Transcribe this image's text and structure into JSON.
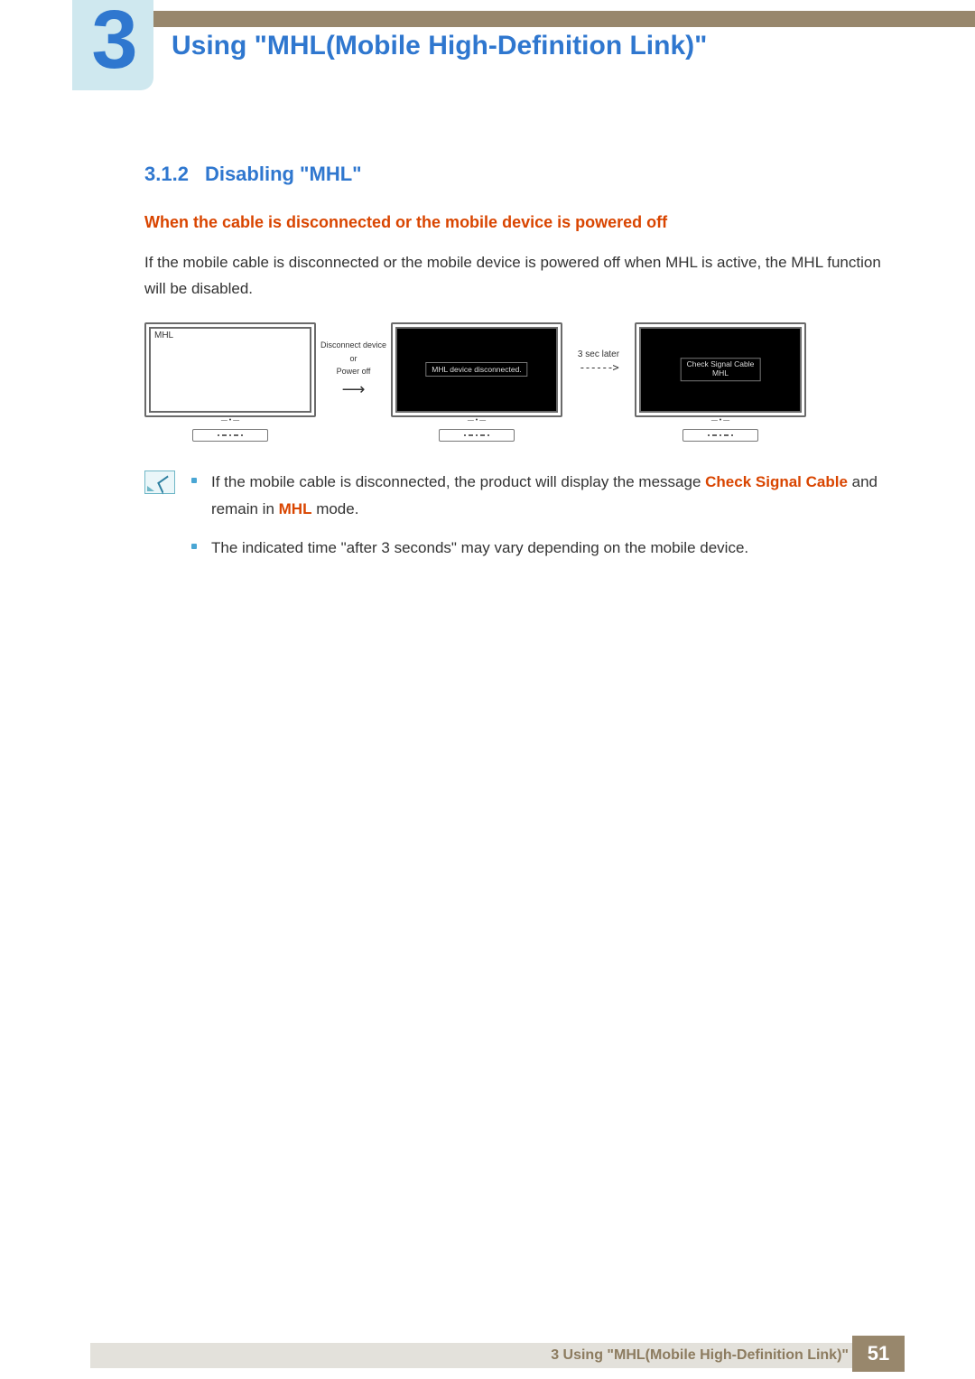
{
  "chapter": {
    "number": "3",
    "title": "Using \"MHL(Mobile High-Definition Link)\""
  },
  "section": {
    "number": "3.1.2",
    "title": "Disabling \"MHL\""
  },
  "subheading": "When the cable is disconnected or the mobile device is powered off",
  "body": "If the mobile cable is disconnected or the mobile device is powered off when MHL is active, the MHL function will be disabled.",
  "diagram": {
    "monitor1_tag": "MHL",
    "arrow1_line1": "Disconnect device",
    "arrow1_line2": "or",
    "arrow1_line3": "Power off",
    "monitor2_msg": "MHL device disconnected.",
    "arrow2_label": "3 sec later",
    "monitor3_msg_line1": "Check Signal Cable",
    "monitor3_msg_line2": "MHL"
  },
  "notes": {
    "item1_prefix": "If the mobile cable is disconnected, the product will display the message ",
    "item1_hl1": "Check Signal Cable",
    "item1_mid": " and remain in ",
    "item1_hl2": "MHL",
    "item1_suffix": " mode.",
    "item2": "The indicated time \"after 3 seconds\" may vary depending on the mobile device."
  },
  "footer": {
    "text": "3 Using \"MHL(Mobile High-Definition Link)\"",
    "page": "51"
  }
}
